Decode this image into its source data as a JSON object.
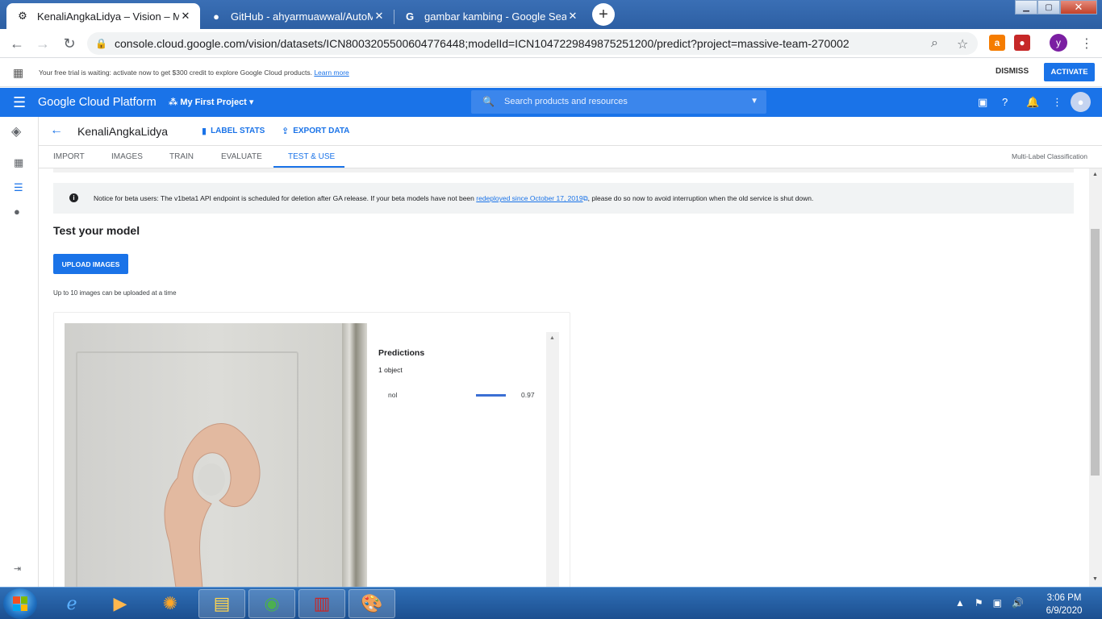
{
  "browser": {
    "tabs": [
      {
        "title": "KenaliAngkaLidya – Vision – My Fi",
        "active": true,
        "icon": "gear-icon"
      },
      {
        "title": "GitHub - ahyarmuawwal/AutoML",
        "active": false,
        "icon": "github-icon"
      },
      {
        "title": "gambar kambing - Google Search",
        "active": false,
        "icon": "google-icon"
      }
    ],
    "new_tab": "+",
    "url": "console.cloud.google.com/vision/datasets/ICN8003205500604776448;modelId=ICN1047229849875251200/predict?project=massive-team-270002",
    "profile_initial": "y"
  },
  "trial": {
    "message": "Your free trial is waiting: activate now to get $300 credit to explore Google Cloud products.",
    "learn_more": "Learn more",
    "dismiss": "DISMISS",
    "activate": "ACTIVATE"
  },
  "gcp": {
    "brand": "Google Cloud Platform",
    "project": "My First Project",
    "search_placeholder": "Search products and resources"
  },
  "dataset": {
    "name": "KenaliAngkaLidya",
    "label_stats": "LABEL STATS",
    "export_data": "EXPORT DATA"
  },
  "tabs": [
    {
      "label": "IMPORT",
      "active": false
    },
    {
      "label": "IMAGES",
      "active": false
    },
    {
      "label": "TRAIN",
      "active": false
    },
    {
      "label": "EVALUATE",
      "active": false
    },
    {
      "label": "TEST & USE",
      "active": true
    }
  ],
  "classification_type": "Multi-Label Classification",
  "notice": {
    "before": "Notice for beta users: The v1beta1 API endpoint is scheduled for deletion after GA release. If your beta models have not been",
    "link": "redeployed since October 17, 2019",
    "after": ", please do so now to avoid interruption when the old service is shut down."
  },
  "test": {
    "title": "Test your model",
    "upload_button": "UPLOAD IMAGES",
    "hint": "Up to 10 images can be uploaded at a time"
  },
  "predictions": {
    "heading": "Predictions",
    "count": "1 object",
    "items": [
      {
        "label": "nol",
        "score": "0.97",
        "score_value": 0.97
      }
    ]
  },
  "taskbar": {
    "time": "3:06 PM",
    "date": "6/9/2020"
  },
  "colors": {
    "accent": "#1a73e8",
    "prediction_bar": "#3b6fd4"
  }
}
